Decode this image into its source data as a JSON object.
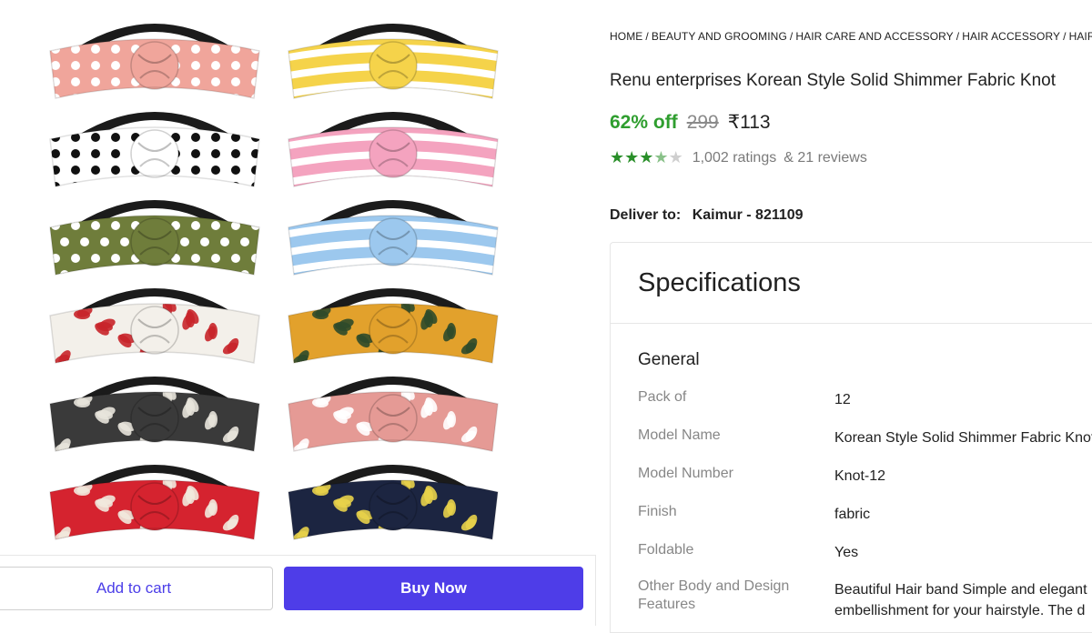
{
  "breadcrumb": {
    "items": [
      "HOME",
      "BEAUTY AND GROOMING",
      "HAIR CARE AND ACCESSORY",
      "HAIR ACCESSORY",
      "HAIR"
    ]
  },
  "product": {
    "title": "Renu enterprises Korean Style Solid Shimmer Fabric Knot",
    "discount": "62% off",
    "mrp": "299",
    "price": "₹113",
    "rating_value": 3.5,
    "ratings": "1,002 ratings",
    "reviews": "& 21 reviews"
  },
  "delivery": {
    "label": "Deliver to:",
    "location": "Kaimur - 821109"
  },
  "actions": {
    "add_to_cart": "Add to cart",
    "buy_now": "Buy Now"
  },
  "specs": {
    "title": "Specifications",
    "section": "General",
    "rows": [
      {
        "key": "Pack of",
        "value": "12"
      },
      {
        "key": "Model Name",
        "value": "Korean Style Solid Shimmer Fabric Knot"
      },
      {
        "key": "Model Number",
        "value": "Knot-12"
      },
      {
        "key": "Finish",
        "value": "fabric"
      },
      {
        "key": "Foldable",
        "value": "Yes"
      },
      {
        "key": "Other Body and Design Features",
        "value": "Beautiful Hair band Simple and elegant embellishment for your hairstyle. The d"
      }
    ]
  },
  "colors": {
    "accent": "#4e3de8",
    "discount": "#2f9e2f",
    "star": "#2a8f2a"
  },
  "headbands": [
    {
      "name": "pink-polka-dot",
      "base": "#f0a59b",
      "pattern": "dots",
      "accent": "#ffffff"
    },
    {
      "name": "yellow-stripe",
      "base": "#f5d34a",
      "pattern": "stripes",
      "accent": "#ffffff"
    },
    {
      "name": "white-black-dot",
      "base": "#ffffff",
      "pattern": "dots",
      "accent": "#111111"
    },
    {
      "name": "pink-stripe",
      "base": "#f4a3bf",
      "pattern": "stripes",
      "accent": "#ffffff"
    },
    {
      "name": "olive-polka-dot",
      "base": "#6f7d3b",
      "pattern": "dots",
      "accent": "#ffffff"
    },
    {
      "name": "blue-stripe",
      "base": "#9cc8ee",
      "pattern": "stripes",
      "accent": "#ffffff"
    },
    {
      "name": "red-floral-white",
      "base": "#f3f0ea",
      "pattern": "floral",
      "accent": "#c8252a"
    },
    {
      "name": "mustard-floral",
      "base": "#e2a12c",
      "pattern": "floral",
      "accent": "#2f4a2a"
    },
    {
      "name": "black-white-leaf",
      "base": "#3a3a3a",
      "pattern": "floral",
      "accent": "#e8e4dc"
    },
    {
      "name": "pink-floral",
      "base": "#e59a95",
      "pattern": "floral",
      "accent": "#ffffff"
    },
    {
      "name": "red-leaf",
      "base": "#d5232f",
      "pattern": "floral",
      "accent": "#f1e9dd"
    },
    {
      "name": "navy-floral",
      "base": "#1c2541",
      "pattern": "floral",
      "accent": "#e8d24a"
    }
  ]
}
